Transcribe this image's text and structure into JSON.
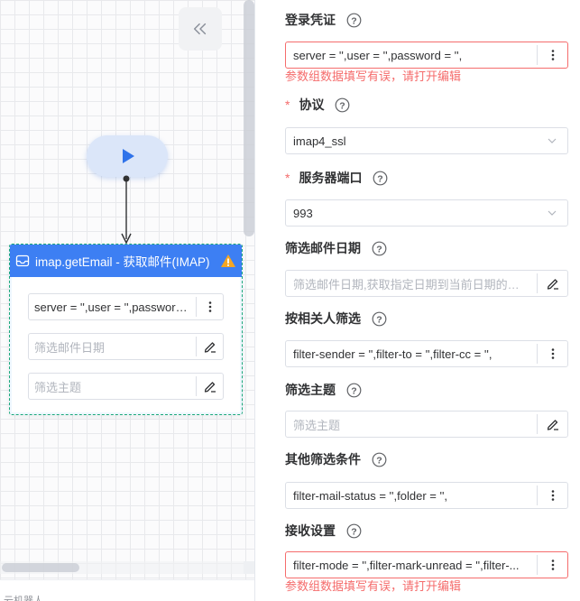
{
  "canvas": {
    "start_node_label": "",
    "email_node": {
      "title": "imap.getEmail - 获取邮件(IMAP)",
      "fields": [
        {
          "value": "server = '',user = '',password = '',",
          "placeholder": "",
          "icon": "more-vertical-icon"
        },
        {
          "value": "",
          "placeholder": "筛选邮件日期",
          "icon": "edit-pen-icon"
        },
        {
          "value": "",
          "placeholder": "筛选主题",
          "icon": "edit-pen-icon"
        }
      ]
    },
    "bottom_text": "云机器人..."
  },
  "properties": {
    "credentials": {
      "label": "登录凭证",
      "value": "server = '',user = '',password = '',",
      "error": "参数组数据填写有误，请打开编辑"
    },
    "protocol": {
      "label": "协议",
      "required": true,
      "value": "imap4_ssl"
    },
    "port": {
      "label": "服务器端口",
      "required": true,
      "value": "993"
    },
    "date_filter": {
      "label": "筛选邮件日期",
      "placeholder": "筛选邮件日期,获取指定日期到当前日期的邮件"
    },
    "contact_filter": {
      "label": "按相关人筛选",
      "value": "filter-sender = '',filter-to = '',filter-cc = '',"
    },
    "subject_filter": {
      "label": "筛选主题",
      "placeholder": "筛选主题"
    },
    "other_filter": {
      "label": "其他筛选条件",
      "value": "filter-mail-status = '',folder = '',"
    },
    "receive_settings": {
      "label": "接收设置",
      "value": "filter-mode = '',filter-mark-unread = '',filter-...",
      "error": "参数组数据填写有误，请打开编辑"
    }
  },
  "colors": {
    "accent": "#3d7ff3",
    "error": "#f56c6c",
    "node_border": "#1aa87a",
    "warning": "#f5a623"
  }
}
